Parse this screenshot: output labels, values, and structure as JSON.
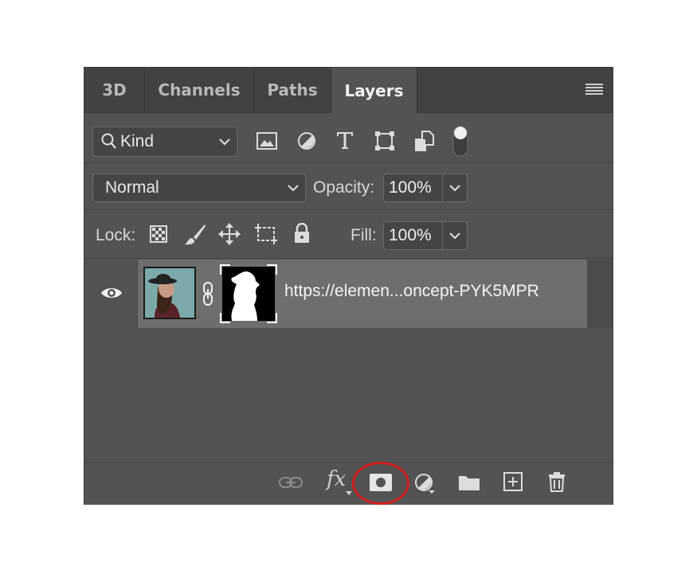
{
  "tabs": [
    {
      "label": "3D",
      "active": false
    },
    {
      "label": "Channels",
      "active": false
    },
    {
      "label": "Paths",
      "active": false
    },
    {
      "label": "Layers",
      "active": true
    }
  ],
  "filter": {
    "kind_label": "Kind",
    "icons": [
      "image-filter-icon",
      "adjustment-filter-icon",
      "type-filter-icon",
      "shape-filter-icon",
      "smart-object-filter-icon",
      "filter-toggle-switch"
    ]
  },
  "blend": {
    "mode": "Normal",
    "opacity_label": "Opacity:",
    "opacity_value": "100%"
  },
  "lock": {
    "label": "Lock:",
    "icons": [
      "lock-transparent-pixels-icon",
      "lock-image-pixels-icon",
      "lock-position-icon",
      "lock-artboard-icon",
      "lock-all-icon"
    ],
    "fill_label": "Fill:",
    "fill_value": "100%"
  },
  "layer": {
    "name": "https://elemen...oncept-PYK5MPR",
    "visible": true
  },
  "footer": {
    "fx_label": "fx",
    "icons": [
      "link-layers-icon",
      "layer-style-icon",
      "add-mask-icon",
      "adjustment-layer-icon",
      "new-group-icon",
      "new-layer-icon",
      "delete-layer-icon"
    ],
    "highlight_color": "#d21f1f"
  }
}
